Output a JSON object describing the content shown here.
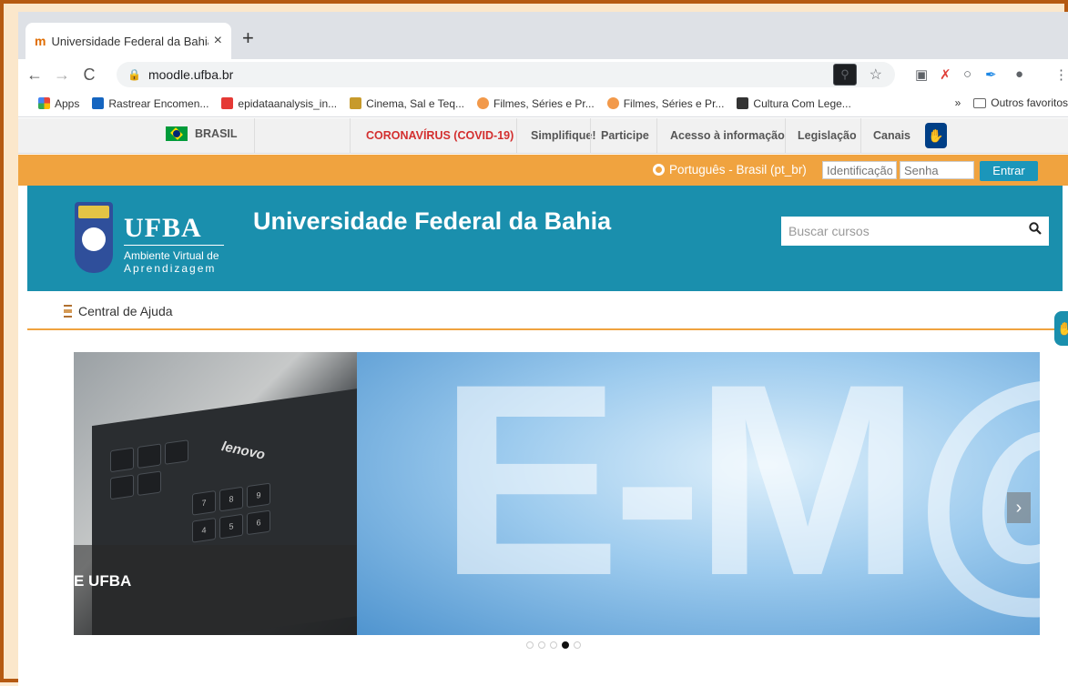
{
  "browser": {
    "tab_title": "Universidade Federal da Bahia",
    "tab_close": "×",
    "new_tab": "+",
    "url": "moodle.ufba.br",
    "back": "←",
    "forward": "→",
    "reload": "C"
  },
  "bookmarks": {
    "items": [
      {
        "label": "Apps",
        "color": "#e8453c"
      },
      {
        "label": "Rastrear Encomen...",
        "color": "#1565c0"
      },
      {
        "label": "epidataanalysis_in...",
        "color": "#e53935"
      },
      {
        "label": "Cinema, Sal e Teq...",
        "color": "#c79a2b"
      },
      {
        "label": "Filmes, Séries e Pr...",
        "color": "#f2994a"
      },
      {
        "label": "Filmes, Séries e Pr...",
        "color": "#f2994a"
      },
      {
        "label": "Cultura Com Lege...",
        "color": "#333333"
      }
    ],
    "more": "»",
    "other_folder": "Outros favoritos"
  },
  "govbar": {
    "brasil": "BRASIL",
    "links": [
      "CORONAVÍRUS (COVID-19)",
      "Simplifique!",
      "Participe",
      "Acesso à informação",
      "Legislação",
      "Canais"
    ],
    "covid_color": "#d32f2f"
  },
  "login": {
    "language": "Português - Brasil (pt_br)",
    "username_placeholder": "Identificação",
    "password_placeholder": "Senha",
    "submit": "Entrar"
  },
  "header": {
    "logo_word": "UFBA",
    "logo_sub1": "Ambiente Virtual de",
    "logo_sub2": "Aprendizagem",
    "title": "Universidade Federal da Bahia",
    "search_placeholder": "Buscar cursos",
    "teal": "#1a8fad",
    "orange": "#f0a33f"
  },
  "help": {
    "label": "Central de Ajuda"
  },
  "carousel": {
    "caption": "E UFBA",
    "slide_text": "E-M@",
    "keyboard_brand": "lenovo",
    "next": "›",
    "dots": 5,
    "active_dot": 4
  }
}
